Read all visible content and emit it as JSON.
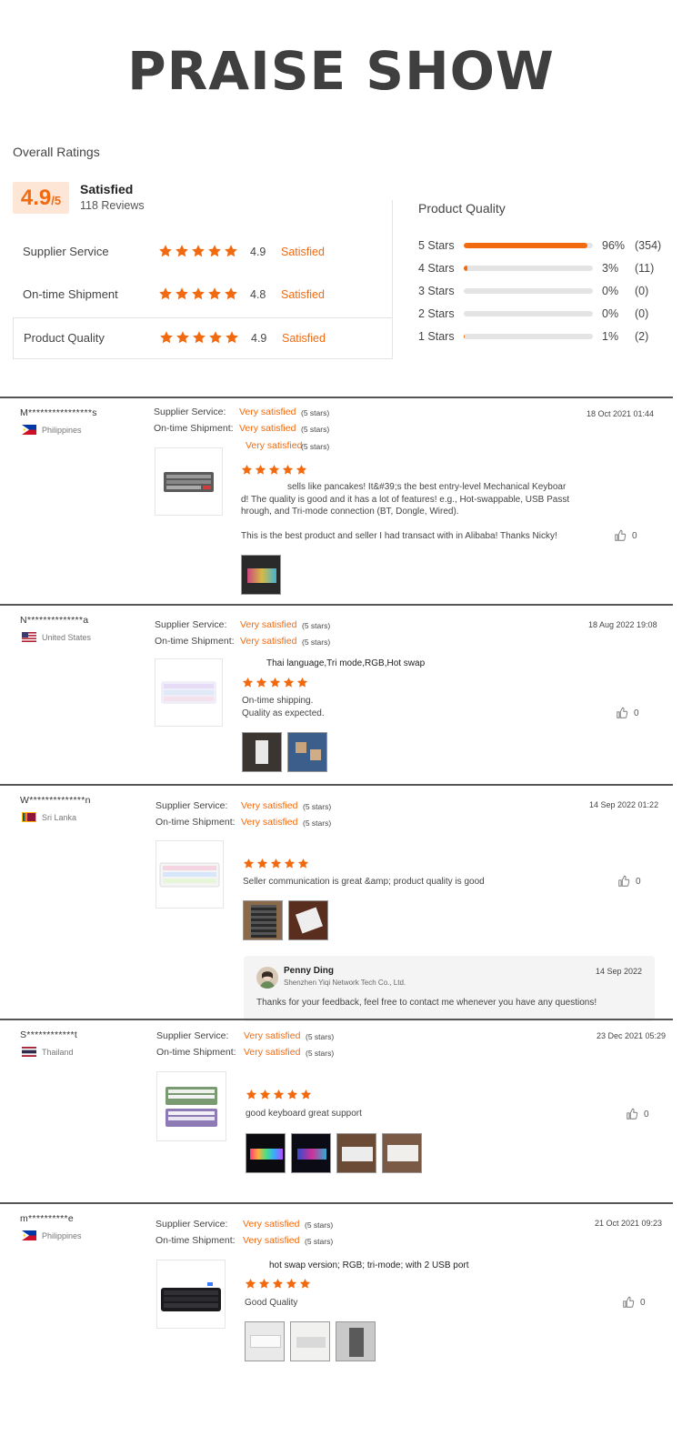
{
  "header": {
    "title": "PRAISE SHOW"
  },
  "overall": {
    "title": "Overall Ratings",
    "score": "4.9",
    "score_max": "/5",
    "label": "Satisfied",
    "reviews": "118 Reviews",
    "ratings": [
      {
        "label": "Supplier Service",
        "stars": 5,
        "score": "4.9",
        "status": "Satisfied"
      },
      {
        "label": "On-time Shipment",
        "stars": 5,
        "score": "4.8",
        "status": "Satisfied"
      },
      {
        "label": "Product Quality",
        "stars": 5,
        "score": "4.9",
        "status": "Satisfied"
      }
    ]
  },
  "product_quality": {
    "title": "Product Quality",
    "rows": [
      {
        "label": "5 Stars",
        "fraction": 0.96,
        "pct": "96%",
        "count": "(354)"
      },
      {
        "label": "4 Stars",
        "fraction": 0.03,
        "pct": "3%",
        "count": "(11)"
      },
      {
        "label": "3 Stars",
        "fraction": 0.0,
        "pct": "0%",
        "count": "(0)"
      },
      {
        "label": "2 Stars",
        "fraction": 0.0,
        "pct": "0%",
        "count": "(0)"
      },
      {
        "label": "1 Stars",
        "fraction": 0.01,
        "pct": "1%",
        "count": "(2)"
      }
    ]
  },
  "labels": {
    "supplier_service": "Supplier Service:",
    "ontime_shipment": "On-time Shipment:",
    "very_satisfied": "Very satisfied",
    "very_satisfied_partial": "Very satisfied",
    "five_stars": "(5 stars)"
  },
  "reviews": [
    {
      "user": "M****************s",
      "country": "Philippines",
      "date": "18 Oct 2021 01:44",
      "variant": "",
      "text1": "sells like pancakes! It&#39;s the best entry-level Mechanical Keyboar",
      "text2": "d! The quality is good and it has a lot of features! e.g., Hot-swappable, USB Passt",
      "text3": "hrough, and Tri-mode connection (BT, Dongle, Wired).",
      "text4": "This is the best product and seller I had transact with in Alibaba! Thanks Nicky!",
      "likes": "0"
    },
    {
      "user": "N**************a",
      "country": "United States",
      "date": "18 Aug 2022 19:08",
      "variant": "Thai language,Tri mode,RGB,Hot swap",
      "text1": "On-time shipping.",
      "text2": "Quality as expected.",
      "likes": "0"
    },
    {
      "user": "W**************n",
      "country": "Sri Lanka",
      "date": "14 Sep 2022 01:22",
      "text1": "Seller communication is great &amp; product quality is good",
      "likes": "0",
      "reply": {
        "name": "Penny Ding",
        "company": "Shenzhen Yiqi Network Tech Co., Ltd.",
        "date": "14 Sep 2022",
        "text": "Thanks for your feedback, feel free to contact me whenever you have any questions!"
      }
    },
    {
      "user": "S************t",
      "country": "Thailand",
      "date": "23 Dec 2021 05:29",
      "text1": "good keyboard great support",
      "likes": "0"
    },
    {
      "user": "m**********e",
      "country": "Philippines",
      "date": "21 Oct 2021 09:23",
      "variant": "hot swap version; RGB; tri-mode; with 2 USB port",
      "text1": "Good Quality",
      "likes": "0"
    }
  ],
  "colors": {
    "accent": "#f26a10",
    "track": "#e4e4e4"
  }
}
